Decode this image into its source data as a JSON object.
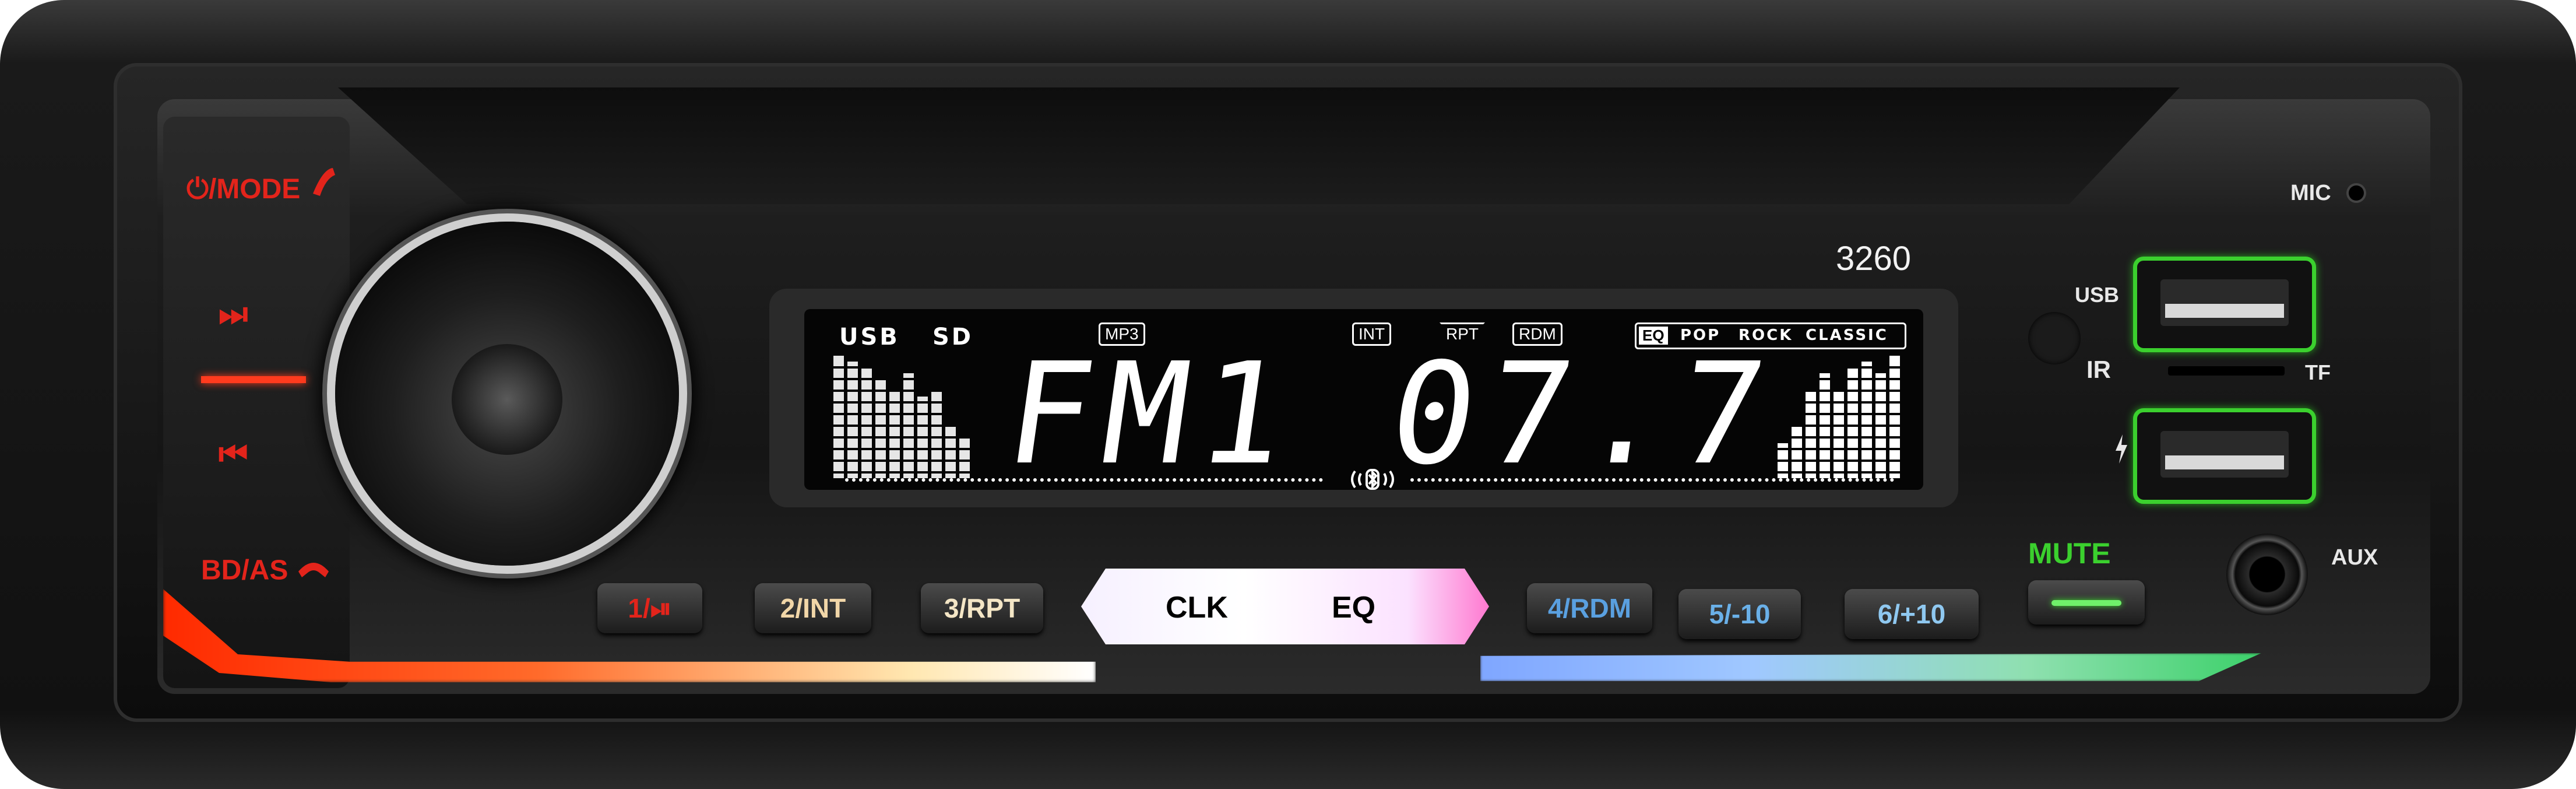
{
  "left_panel": {
    "mode_label": "⏻/MODE",
    "mode_icon": "hangup-icon",
    "next_icon": "⏭",
    "prev_icon": "⏮",
    "bdas_label": "BD/AS",
    "bdas_icon": "phone-icon"
  },
  "model_number": "3260",
  "display": {
    "sources": [
      "USB",
      "SD"
    ],
    "mp3": "MP3",
    "indicators": [
      "INT",
      "RPT",
      "RDM"
    ],
    "eq_label": "EQ",
    "eq_modes": [
      "POP",
      "ROCK",
      "CLASSIC"
    ],
    "frequency": "FM1 07.7",
    "bluetooth_icon": "bluetooth-icon"
  },
  "buttons": {
    "b1": "1/⏯",
    "b2": "2/INT",
    "b3": "3/RPT",
    "clk": "CLK",
    "eq": "EQ",
    "b4": "4/RDM",
    "b5": "5/-10",
    "b6": "6/+10",
    "mute": "MUTE"
  },
  "right_panel": {
    "mic": "MIC",
    "usb": "USB",
    "ir": "IR",
    "tf": "TF",
    "aux": "AUX",
    "charge_icon": "lightning-icon"
  },
  "colors": {
    "red_accent": "#e3241b",
    "green_accent": "#3bd02e",
    "blue_accent": "#5aa0e0",
    "beige_accent": "#f1d6a8"
  }
}
